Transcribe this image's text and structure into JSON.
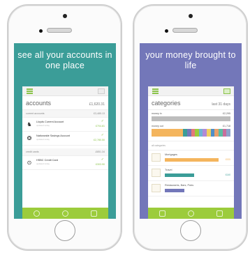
{
  "left_phone": {
    "headline": "see all your accounts in one place",
    "accounts": {
      "title": "accounts",
      "total": "£1,620.31",
      "sections": [
        {
          "label": "current accounts",
          "amount": "£3,485.13",
          "items": [
            {
              "name": "Lloyds Current Account",
              "sub": "updated today",
              "amount": "£704.81"
            },
            {
              "name": "Nationwide Savings Account",
              "sub": "updated today",
              "amount": "£2,780.50"
            }
          ]
        },
        {
          "label": "credit cards",
          "amount": "-£851.34",
          "items": [
            {
              "name": "HSBC Credit Card",
              "sub": "updated today",
              "amount": "£303.90"
            }
          ]
        }
      ]
    }
  },
  "right_phone": {
    "headline": "your money brought to life",
    "categories": {
      "title": "categories",
      "period": "last 31 days",
      "money_in_label": "money in",
      "money_in_amount": "£2,295",
      "money_out_label": "money out",
      "money_out_amount": "£1,718",
      "all_label": "all categories",
      "items": [
        {
          "name": "Mortgages",
          "amount": "£925",
          "color": "#f4b55d",
          "fill": 0.82
        },
        {
          "name": "Travel",
          "amount": "£140",
          "color": "#3b9d98",
          "fill": 0.45
        },
        {
          "name": "Restaurants, Bars, Pubs",
          "amount": "",
          "color": "#7377b9",
          "fill": 0.3
        }
      ],
      "spend_colors": [
        "#f4b55d",
        "#f4b55d",
        "#3b9d98",
        "#7377b9",
        "#e57a7a",
        "#9ccc3c",
        "#6fb3d6",
        "#b28ad6",
        "#f0d060",
        "#4e8fc9",
        "#e9a06a",
        "#5bbfa3",
        "#c86f9c",
        "#8ea2cc"
      ]
    }
  },
  "colors": {
    "teal": "#3b9d98",
    "purple": "#7377b9",
    "accent_green": "#9ccc3c"
  }
}
